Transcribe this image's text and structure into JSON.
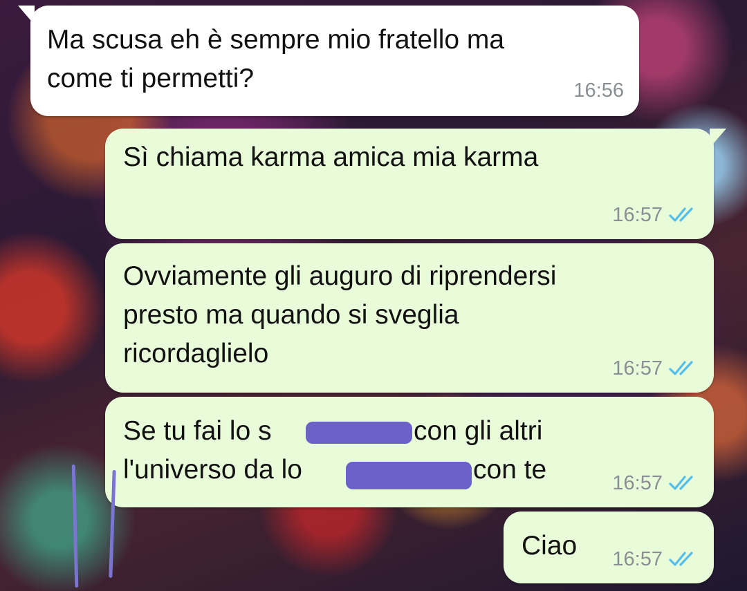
{
  "messages": [
    {
      "direction": "incoming",
      "text": "Ma scusa eh è sempre mio fratello ma\ncome ti permetti?",
      "time": "16:56"
    },
    {
      "direction": "outgoing",
      "text": "Sì chiama karma amica mia karma",
      "time": "16:57",
      "status": "read"
    },
    {
      "direction": "outgoing",
      "text": "Ovviamente gli auguro di riprendersi\npresto ma quando si sveglia\nricordaglielo",
      "time": "16:57",
      "status": "read"
    },
    {
      "direction": "outgoing",
      "line1_start": "Se tu fai lo s",
      "line1_end": "con gli altri",
      "line2_start": "l'universo da lo",
      "line2_end": "con te",
      "time": "16:57",
      "status": "read"
    },
    {
      "direction": "outgoing",
      "text": "Ciao",
      "time": "16:57",
      "status": "read"
    }
  ],
  "icons": {
    "read_receipt": "double-check-icon"
  },
  "colors": {
    "incoming_bubble": "#ffffff",
    "outgoing_bubble": "#e8fcd9",
    "timestamp": "#8a8f93",
    "read_ticks": "#53bdeb",
    "redaction": "#6a62c9",
    "annotation_strokes": "#7b74d3"
  }
}
